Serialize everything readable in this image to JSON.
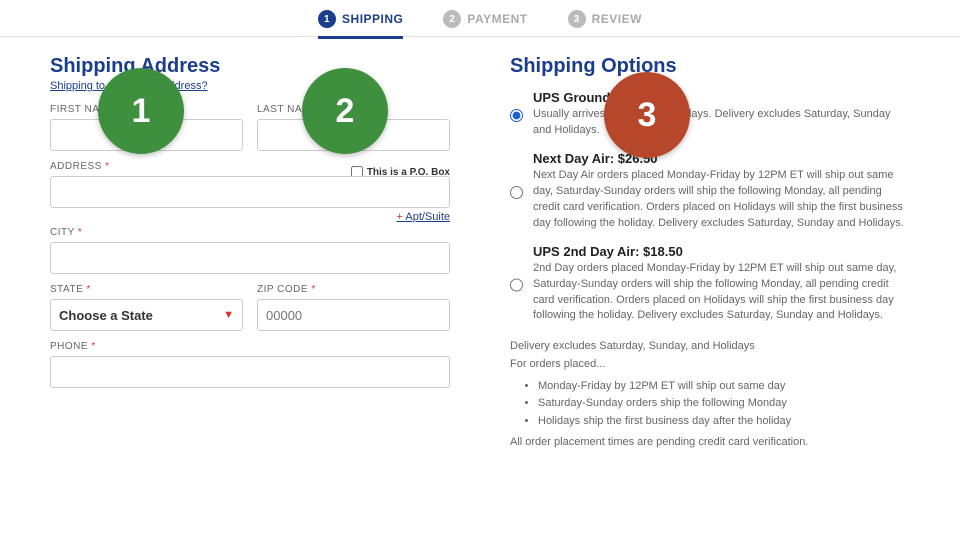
{
  "stepper": {
    "steps": [
      {
        "num": "1",
        "label": "SHIPPING"
      },
      {
        "num": "2",
        "label": "PAYMENT"
      },
      {
        "num": "3",
        "label": "REVIEW"
      }
    ]
  },
  "address": {
    "heading": "Shipping Address",
    "sublink": "Shipping to a Different Address?",
    "first_name_label": "FIRST NAME",
    "last_name_label": "LAST NAME",
    "address_label": "ADDRESS",
    "pobox_label": "This is a P.O. Box",
    "apt_link": "Apt/Suite",
    "city_label": "CITY",
    "state_label": "STATE",
    "state_placeholder": "Choose a State",
    "zip_label": "ZIP CODE",
    "zip_placeholder": "00000",
    "phone_label": "PHONE"
  },
  "shipping": {
    "heading": "Shipping Options",
    "options": [
      {
        "title": "UPS Ground",
        "desc": "Usually arrives in 5-7 business days. Delivery excludes Saturday, Sunday and Holidays."
      },
      {
        "title": "Next Day Air: $26.50",
        "desc": "Next Day Air orders placed Monday-Friday by 12PM ET will ship out same day, Saturday-Sunday orders will ship the following Monday, all pending credit card verification. Orders placed on Holidays will ship the first business day following the holiday. Delivery excludes Saturday, Sunday and Holidays."
      },
      {
        "title": "UPS 2nd Day Air: $18.50",
        "desc": "2nd Day orders placed Monday-Friday by 12PM ET will ship out same day, Saturday-Sunday orders will ship the following Monday, all pending credit card verification. Orders placed on Holidays will ship the first business day following the holiday. Delivery excludes Saturday, Sunday and Holidays."
      }
    ],
    "notes": {
      "exclude": "Delivery excludes Saturday, Sunday, and Holidays",
      "placed_intro": "For orders placed...",
      "bullets": [
        "Monday-Friday by 12PM ET will ship out same day",
        "Saturday-Sunday orders ship the following Monday",
        "Holidays ship the first business day after the holiday"
      ],
      "pending": "All order placement times are pending credit card verification."
    }
  },
  "badges": {
    "b1": "1",
    "b2": "2",
    "b3": "3"
  }
}
